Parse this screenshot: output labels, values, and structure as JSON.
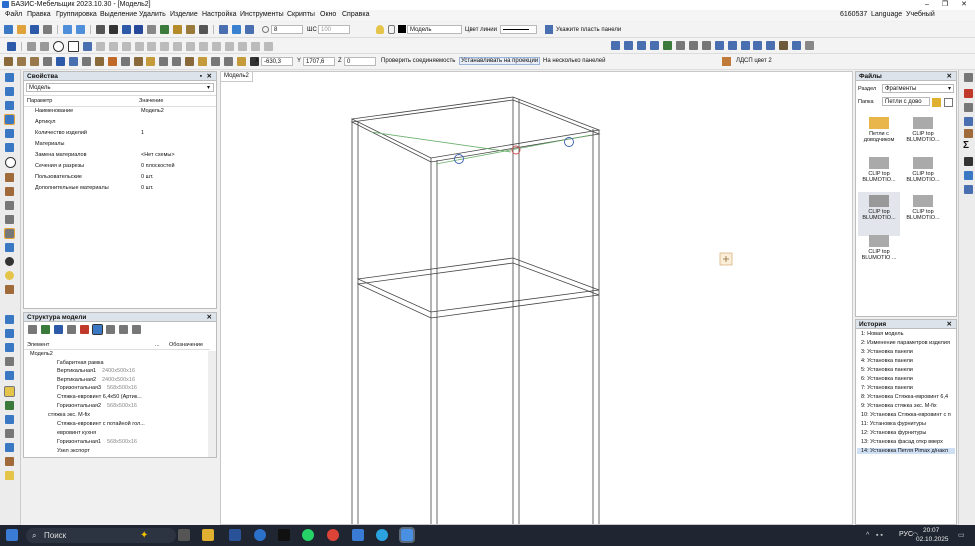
{
  "window": {
    "title": "БАЗИС-Мебельщик 2023.10.30 - [Модель2]"
  },
  "menu": [
    "Файл",
    "Правка",
    "Группировка",
    "Выделение",
    "Удалить",
    "Изделие",
    "Настройка",
    "Инструменты",
    "Скрипты",
    "Окно",
    "Справка"
  ],
  "menu_right": {
    "code": "6160537",
    "language": "Language",
    "mode": "Учебный"
  },
  "toolbar": {
    "layer_value": "8",
    "thickness_label": "ШС",
    "thickness_value": "100",
    "model_value": "Модель",
    "line_color_label": "Цвет линии",
    "panel_hint": "Укажите пласть панели",
    "x_label": "X",
    "x_value": "-630,3",
    "y_label": "Y",
    "y_value": "1707,6",
    "z_label": "Z",
    "z_value": "0",
    "check_connections": "Проверить соединяемость",
    "install_projections": "Устанавливать на проекции",
    "on_multiple_panels": "На несколько панелей",
    "material": "ЛДСП цвет 2"
  },
  "properties": {
    "title": "Свойства",
    "object": "Модель",
    "col_param": "Параметр",
    "col_value": "Значение",
    "rows": [
      {
        "name": "Наименование",
        "value": "Модель2"
      },
      {
        "name": "Артикул",
        "value": ""
      },
      {
        "name": "Количество изделий",
        "value": "1"
      },
      {
        "name": "Материалы",
        "value": ""
      },
      {
        "name": "Замена материалов",
        "value": "<Нет схемы>"
      },
      {
        "name": "Сечения и разрезы",
        "value": "0 плоскостей"
      },
      {
        "name": "Пользовательские",
        "value": "0 шт."
      },
      {
        "name": "Дополнительные материалы",
        "value": "0 шт."
      }
    ]
  },
  "structure": {
    "title": "Структура модели",
    "col_element": "Элемент",
    "col_dots": "...",
    "col_designation": "Обозначение",
    "root": "Модель2",
    "items": [
      {
        "name": "Габаритная рамка",
        "size": ""
      },
      {
        "name": "Вертикальная1",
        "size": "2400x500x16"
      },
      {
        "name": "Вертикальная2",
        "size": "2400x500x16"
      },
      {
        "name": "Горизонтальная3",
        "size": "568x500x16"
      },
      {
        "name": "Стяжка-евровинт 6,4x50 (Артик...",
        "size": ""
      },
      {
        "name": "стяжка экс. М-fix",
        "size": ""
      },
      {
        "name": "Стяжка-евровинт с потайной гол...",
        "size": ""
      },
      {
        "name": "Горизонтальная2",
        "size": "568x500x16"
      },
      {
        "name": "евровинт кухня",
        "size": ""
      },
      {
        "name": "Горизонтальная1",
        "size": "568x500x16"
      },
      {
        "name": "Узел экспорт",
        "size": ""
      }
    ]
  },
  "doc_tab": "Модель2",
  "files": {
    "title": "Файлы",
    "section_label": "Раздел",
    "section_value": "Фрагменты",
    "folder_label": "Папка",
    "folder_value": "Петли с дово",
    "thumbs": [
      "Петли с доводчиком",
      "CLIP top BLUMOTIO...",
      "CLIP top BLUMOTIO...",
      "CLIP top BLUMOTIO...",
      "CLIP top BLUMOTIO...",
      "CLIP top BLUMOTIO...",
      "CLIP top BLUMOTIO ..."
    ]
  },
  "history": {
    "title": "История",
    "items": [
      "1:  Новая модель",
      "2:  Изменение параметров изделия",
      "3:  Установка панели",
      "4:  Установка панели",
      "5:  Установка панели",
      "6:  Установка панели",
      "7:  Установка панели",
      "8:  Установка Стяжка-евровинт 6,4",
      "9:  Установка стяжка экс. M-fix",
      "10:  Установка Стяжка-евровинт с п",
      "11:  Установка фурнитуры",
      "12:  Установка фурнитуры",
      "13:  Установка фасад откр вверх",
      "14:  Установка Петля Pimax д/накл"
    ],
    "selected_index": 13
  },
  "taskbar": {
    "search": "Поиск",
    "lang": "РУС",
    "time": "20:07",
    "date": "02.10.2025"
  },
  "colors": {
    "accent": "#0a64c8",
    "taskbar": "#1f2631",
    "selection": "#cfe0f4"
  }
}
